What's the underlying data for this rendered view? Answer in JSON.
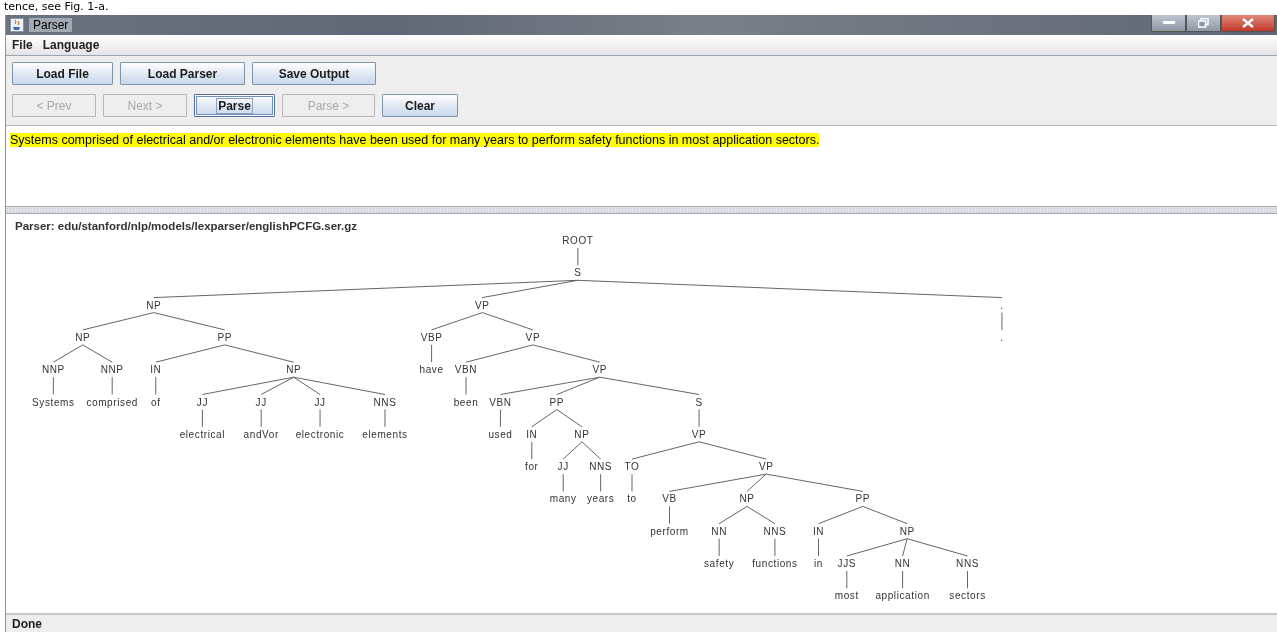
{
  "document_fragment": "tence, see Fig. 1-a.",
  "window": {
    "title": "Parser"
  },
  "menu": [
    "File",
    "Language"
  ],
  "toolbar_rows": [
    [
      {
        "label": "Load File",
        "disabled": false,
        "focused": false
      },
      {
        "label": "Load Parser",
        "disabled": false,
        "focused": false
      },
      {
        "label": "Save Output",
        "disabled": false,
        "focused": false
      }
    ],
    [
      {
        "label": "< Prev",
        "disabled": true,
        "focused": false
      },
      {
        "label": "Next >",
        "disabled": true,
        "focused": false
      },
      {
        "label": "Parse",
        "disabled": false,
        "focused": true
      },
      {
        "label": "Parse >",
        "disabled": true,
        "focused": false
      },
      {
        "label": "Clear",
        "disabled": false,
        "focused": false
      }
    ]
  ],
  "input_text": {
    "text": "Systems comprised of electrical and/or electronic elements have been used for many years to perform safety functions in most application sectors.",
    "highlighted": true
  },
  "parser_label": "Parser: edu/stanford/nlp/models/lexparser/englishPCFG.ser.gz",
  "tree": {
    "label": "ROOT",
    "children": [
      {
        "label": "S",
        "children": [
          {
            "label": "NP",
            "children": [
              {
                "label": "NP",
                "children": [
                  {
                    "label": "NNP",
                    "children": [
                      {
                        "label": "Systems"
                      }
                    ]
                  },
                  {
                    "label": "NNP",
                    "children": [
                      {
                        "label": "comprised"
                      }
                    ]
                  }
                ]
              },
              {
                "label": "PP",
                "children": [
                  {
                    "label": "IN",
                    "children": [
                      {
                        "label": "of"
                      }
                    ]
                  },
                  {
                    "label": "NP",
                    "children": [
                      {
                        "label": "JJ",
                        "children": [
                          {
                            "label": "electrical"
                          }
                        ]
                      },
                      {
                        "label": "JJ",
                        "children": [
                          {
                            "label": "andVor"
                          }
                        ]
                      },
                      {
                        "label": "JJ",
                        "children": [
                          {
                            "label": "electronic"
                          }
                        ]
                      },
                      {
                        "label": "NNS",
                        "children": [
                          {
                            "label": "elements"
                          }
                        ]
                      }
                    ]
                  }
                ]
              }
            ]
          },
          {
            "label": "VP",
            "children": [
              {
                "label": "VBP",
                "children": [
                  {
                    "label": "have"
                  }
                ]
              },
              {
                "label": "VP",
                "children": [
                  {
                    "label": "VBN",
                    "children": [
                      {
                        "label": "been"
                      }
                    ]
                  },
                  {
                    "label": "VP",
                    "children": [
                      {
                        "label": "VBN",
                        "children": [
                          {
                            "label": "used"
                          }
                        ]
                      },
                      {
                        "label": "PP",
                        "children": [
                          {
                            "label": "IN",
                            "children": [
                              {
                                "label": "for"
                              }
                            ]
                          },
                          {
                            "label": "NP",
                            "children": [
                              {
                                "label": "JJ",
                                "children": [
                                  {
                                    "label": "many"
                                  }
                                ]
                              },
                              {
                                "label": "NNS",
                                "children": [
                                  {
                                    "label": "years"
                                  }
                                ]
                              }
                            ]
                          }
                        ]
                      },
                      {
                        "label": "S",
                        "children": [
                          {
                            "label": "VP",
                            "children": [
                              {
                                "label": "TO",
                                "children": [
                                  {
                                    "label": "to"
                                  }
                                ]
                              },
                              {
                                "label": "VP",
                                "children": [
                                  {
                                    "label": "VB",
                                    "children": [
                                      {
                                        "label": "perform"
                                      }
                                    ]
                                  },
                                  {
                                    "label": "NP",
                                    "children": [
                                      {
                                        "label": "NN",
                                        "children": [
                                          {
                                            "label": "safety"
                                          }
                                        ]
                                      },
                                      {
                                        "label": "NNS",
                                        "children": [
                                          {
                                            "label": "functions"
                                          }
                                        ]
                                      }
                                    ]
                                  },
                                  {
                                    "label": "PP",
                                    "children": [
                                      {
                                        "label": "IN",
                                        "children": [
                                          {
                                            "label": "in"
                                          }
                                        ]
                                      },
                                      {
                                        "label": "NP",
                                        "children": [
                                          {
                                            "label": "JJS",
                                            "children": [
                                              {
                                                "label": "most"
                                              }
                                            ]
                                          },
                                          {
                                            "label": "NN",
                                            "children": [
                                              {
                                                "label": "application"
                                              }
                                            ]
                                          },
                                          {
                                            "label": "NNS",
                                            "children": [
                                              {
                                                "label": "sectors"
                                              }
                                            ]
                                          }
                                        ]
                                      }
                                    ]
                                  }
                                ]
                              }
                            ]
                          }
                        ]
                      }
                    ]
                  }
                ]
              }
            ]
          },
          {
            "label": ".",
            "children": [
              {
                "label": "."
              }
            ]
          }
        ]
      }
    ]
  },
  "status_bar": "Done"
}
